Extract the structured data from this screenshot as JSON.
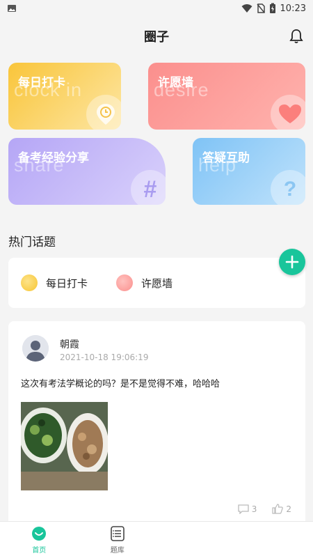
{
  "status": {
    "time": "10:23"
  },
  "header": {
    "title": "圈子",
    "bell_icon": "bell-icon"
  },
  "cards": [
    {
      "label": "每日打卡",
      "ghost": "clock in",
      "icon": "location-clock-icon"
    },
    {
      "label": "许愿墙",
      "ghost": "desire",
      "icon": "heart-icon"
    },
    {
      "label": "备考经验分享",
      "ghost": "share",
      "icon": "hash-icon"
    },
    {
      "label": "答疑互助",
      "ghost": "help",
      "icon": "question-icon"
    }
  ],
  "hot_topics": {
    "title": "热门话题",
    "items": [
      {
        "label": "每日打卡",
        "color": "#f9c53a"
      },
      {
        "label": "许愿墙",
        "color": "#fb8f8d"
      }
    ]
  },
  "post": {
    "author": "朝霞",
    "time": "2021-10-18 19:06:19",
    "content": "这次有考法学概论的吗？是不是觉得不难，哈哈哈",
    "comments": "3",
    "likes": "2"
  },
  "tabbar": [
    {
      "label": "首页",
      "active": true
    },
    {
      "label": "题库",
      "active": false
    },
    {
      "label": "",
      "active": false
    },
    {
      "label": "",
      "active": false
    }
  ],
  "colors": {
    "accent": "#19c59b"
  }
}
